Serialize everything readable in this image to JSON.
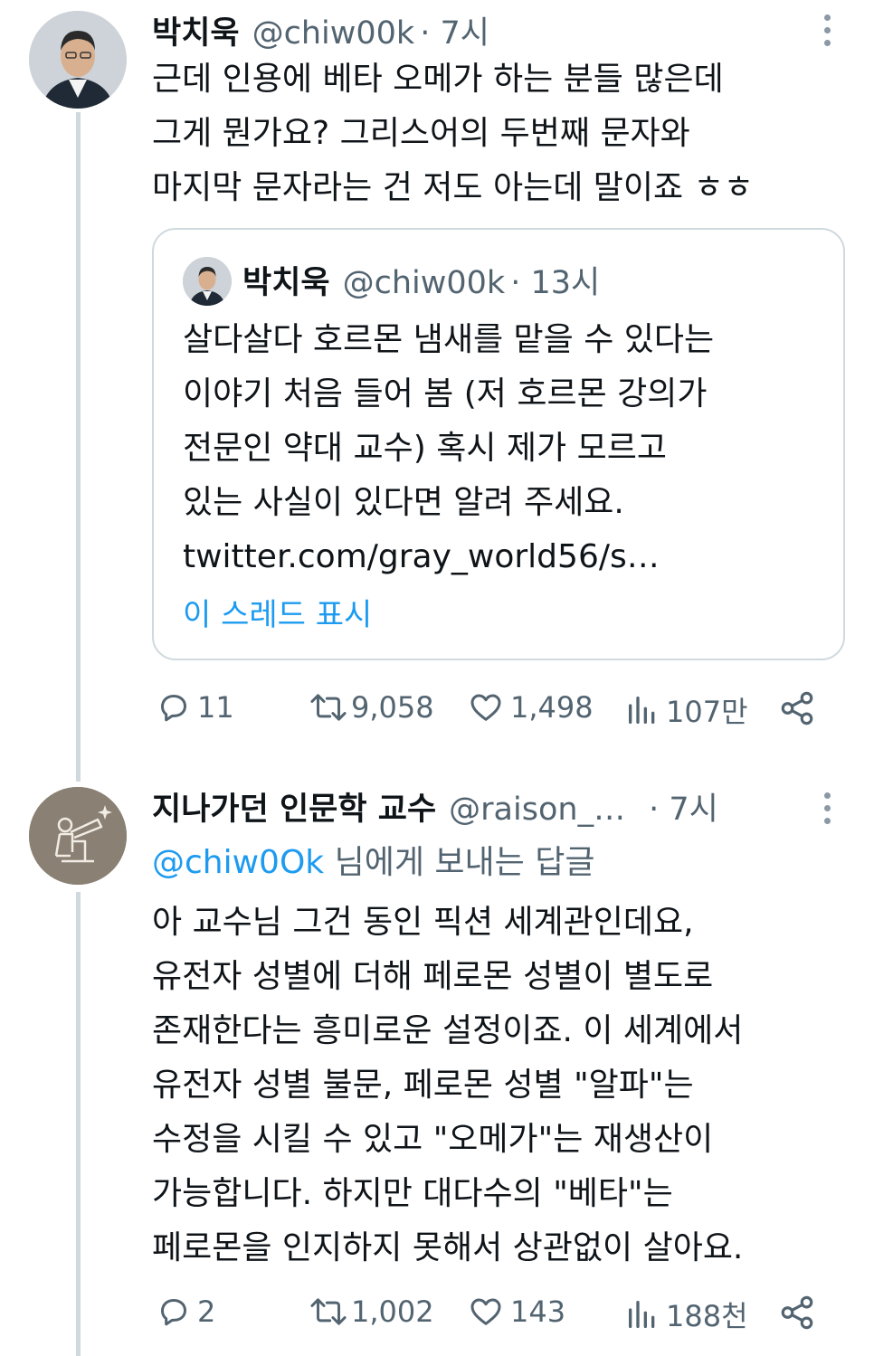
{
  "tweet1": {
    "name": "박치욱",
    "handle": "@chiw00k",
    "time": "· 7시",
    "lines": [
      "근데 인용에 베타 오메가 하는 분들 많은데",
      "그게 뭔가요? 그리스어의 두번째 문자와",
      "마지막 문자라는 건 저도 아는데 말이죠 ㅎㅎ"
    ],
    "quote": {
      "name": "박치욱",
      "handle": "@chiw00k",
      "time": "· 13시",
      "lines": [
        "살다살다 호르몬 냄새를 맡을 수 있다는",
        "이야기 처음 들어 봄 (저 호르몬 강의가",
        "전문인 약대 교수) 혹시 제가 모르고",
        "있는 사실이 있다면 알려 주세요.",
        "twitter.com/gray_world56/s…"
      ],
      "show_thread": "이 스레드 표시"
    },
    "stats": {
      "replies": "11",
      "retweets": "9,058",
      "likes": "1,498",
      "views": "107만"
    }
  },
  "tweet2": {
    "name": "지나가던 인문학 교수",
    "handle": "@raison_…",
    "time": "· 7시",
    "reply_mention": "@chiw0Ok",
    "reply_suffix": " 님에게 보내는 답글",
    "lines": [
      "아 교수님 그건 동인 픽션 세계관인데요,",
      "유전자 성별에 더해 페로몬 성별이 별도로",
      "존재한다는 흥미로운 설정이죠. 이 세계에서",
      "유전자 성별 불문, 페로몬 성별 \"알파\"는",
      "수정을 시킬 수 있고 \"오메가\"는 재생산이",
      "가능합니다. 하지만 대다수의 \"베타\"는",
      "페로몬을 인지하지 못해서 상관없이 살아요."
    ],
    "stats": {
      "replies": "2",
      "retweets": "1,002",
      "likes": "143",
      "views": "188천"
    }
  },
  "colors": {
    "accent": "#1d9bf0",
    "secondary_text": "#536471",
    "border": "#cfd9de"
  }
}
